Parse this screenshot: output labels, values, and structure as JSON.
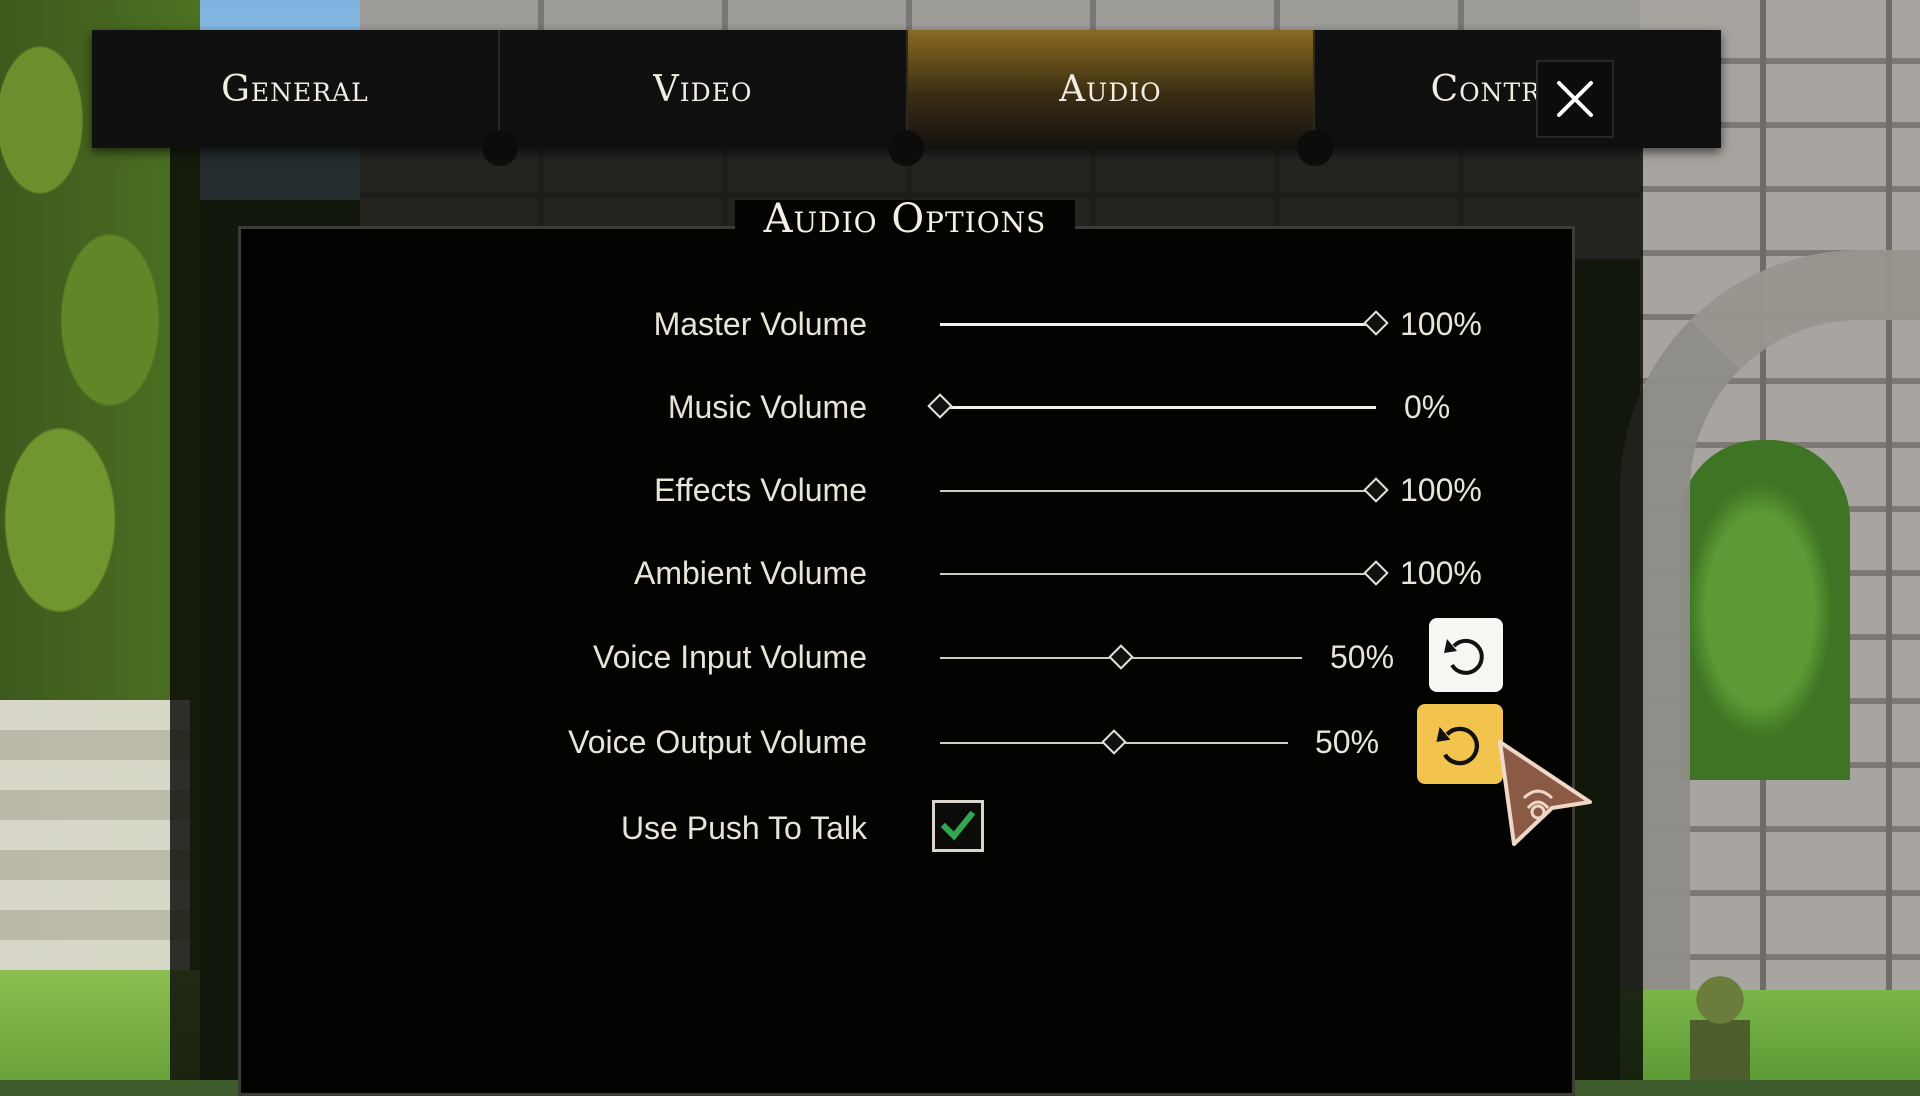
{
  "tabs": [
    {
      "label": "General",
      "active": false
    },
    {
      "label": "Video",
      "active": false
    },
    {
      "label": "Audio",
      "active": true
    },
    {
      "label": "Contr",
      "active": false
    }
  ],
  "close_icon": "close-icon",
  "section_title": "Audio Options",
  "settings": [
    {
      "label": "Master Volume",
      "value_text": "100%",
      "level": 1.0
    },
    {
      "label": "Music Volume",
      "value_text": "0%",
      "level": 0.0
    },
    {
      "label": "Effects Volume",
      "value_text": "100%",
      "level": 1.0
    },
    {
      "label": "Ambient Volume",
      "value_text": "100%",
      "level": 1.0
    },
    {
      "label": "Voice Input Volume",
      "value_text": "50%",
      "level": 0.5,
      "reset_icon": "reset-icon"
    },
    {
      "label": "Voice Output Volume",
      "value_text": "50%",
      "level": 0.5,
      "reset_icon": "reset-icon"
    }
  ],
  "push_to_talk": {
    "label": "Use Push To Talk",
    "checked": true
  },
  "colors": {
    "accent_gold": "#f2c44e",
    "check_green": "#2fa84f",
    "active_tab": "#8a6a22"
  }
}
